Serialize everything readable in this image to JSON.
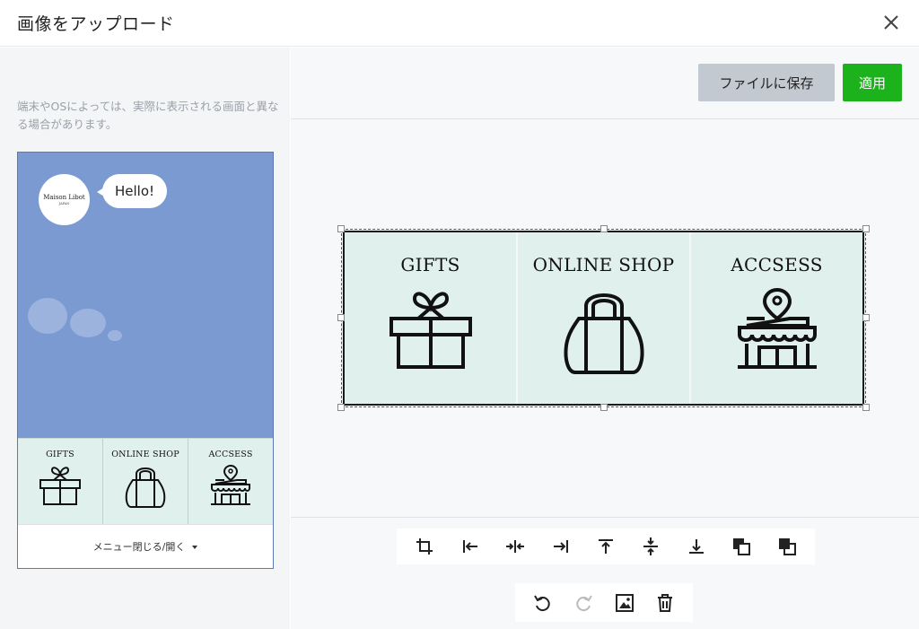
{
  "dialog": {
    "title": "画像をアップロード"
  },
  "preview": {
    "note": "端末やOSによっては、実際に表示される画面と異なる場合があります。",
    "avatar_brand": "Maison Libot",
    "avatar_sub": "JAPAN",
    "bubble_text": "Hello!",
    "footer_label": "メニュー閉じる/開く"
  },
  "toolbar": {
    "save_label": "ファイルに保存",
    "apply_label": "適用"
  },
  "menu": {
    "items": [
      {
        "label": "GIFTS",
        "icon": "gift-icon"
      },
      {
        "label": "ONLINE SHOP",
        "icon": "bag-icon"
      },
      {
        "label": "ACCSESS",
        "icon": "store-icon"
      }
    ]
  },
  "tools": {
    "row1": [
      "crop-icon",
      "align-left-icon",
      "align-center-horizontal-icon",
      "align-right-icon",
      "align-top-icon",
      "align-center-vertical-icon",
      "align-bottom-icon",
      "bring-front-icon",
      "send-back-icon"
    ],
    "row2": [
      "undo-icon",
      "redo-icon",
      "image-icon",
      "trash-icon"
    ]
  },
  "colors": {
    "apply_button": "#1bb21b",
    "save_button": "#c3c9d1",
    "chat_background": "#7b9ad2",
    "menu_background": "#e0f0ec"
  }
}
